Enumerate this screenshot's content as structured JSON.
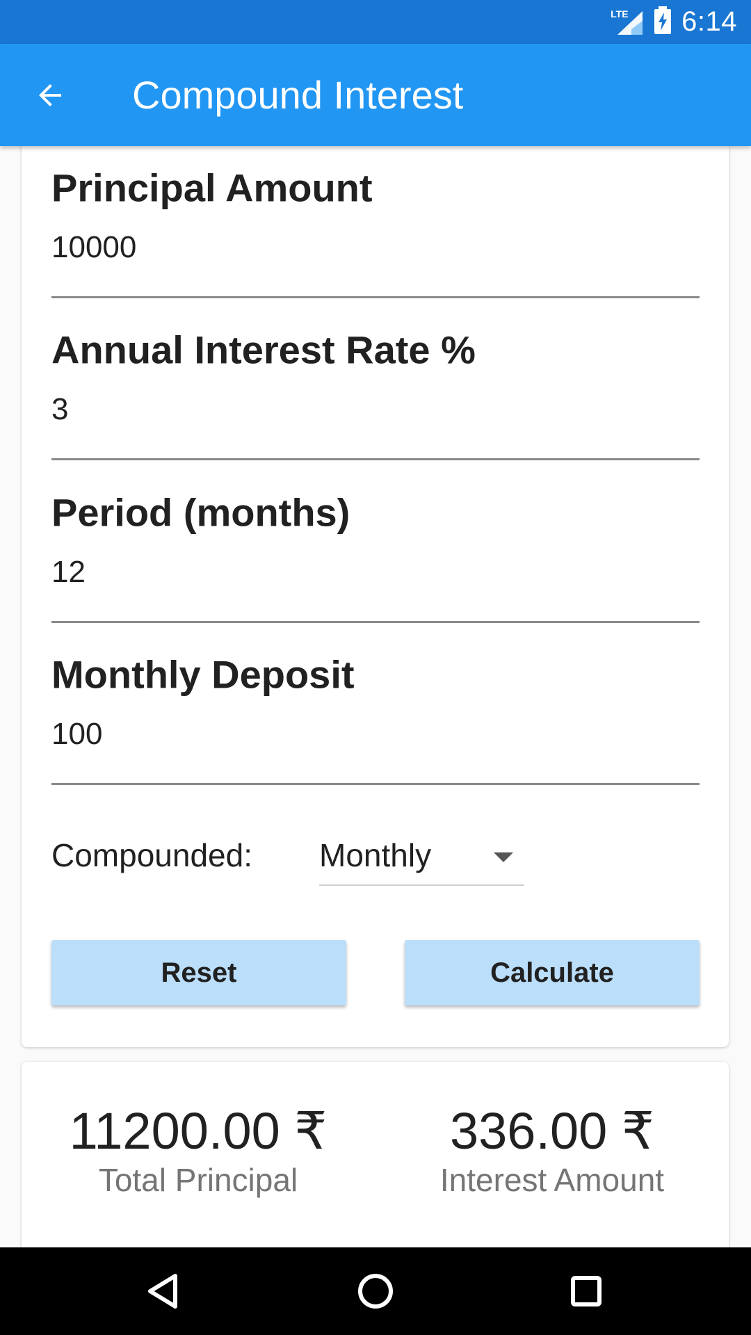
{
  "status_bar": {
    "network_label": "LTE",
    "time": "6:14"
  },
  "app_bar": {
    "title": "Compound Interest",
    "back_icon": "arrow-back-icon"
  },
  "form": {
    "fields": [
      {
        "label": "Principal Amount",
        "value": "10000"
      },
      {
        "label": "Annual Interest Rate %",
        "value": "3"
      },
      {
        "label": "Period (months)",
        "value": "12"
      },
      {
        "label": "Monthly Deposit",
        "value": "100"
      }
    ],
    "compounded_label": "Compounded:",
    "compounded_value": "Monthly",
    "reset_label": "Reset",
    "calculate_label": "Calculate"
  },
  "results": {
    "total_principal_value": "11200.00 ₹",
    "total_principal_label": "Total Principal",
    "interest_value": "336.00 ₹",
    "interest_label": "Interest Amount"
  },
  "nav": {
    "back_icon": "nav-back-triangle-icon",
    "home_icon": "nav-home-circle-icon",
    "recent_icon": "nav-recents-square-icon"
  },
  "colors": {
    "status_bar": "#1976d2",
    "app_bar": "#2196f3",
    "button_bg": "#bbdefb",
    "background": "#fafafa"
  }
}
